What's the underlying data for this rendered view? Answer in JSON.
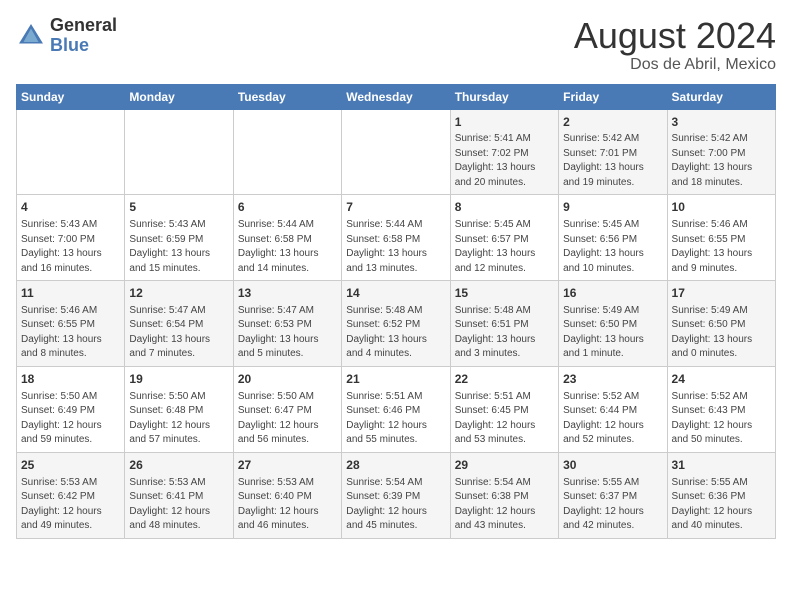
{
  "header": {
    "logo_general": "General",
    "logo_blue": "Blue",
    "title": "August 2024",
    "subtitle": "Dos de Abril, Mexico"
  },
  "weekdays": [
    "Sunday",
    "Monday",
    "Tuesday",
    "Wednesday",
    "Thursday",
    "Friday",
    "Saturday"
  ],
  "weeks": [
    [
      {
        "day": "",
        "info": ""
      },
      {
        "day": "",
        "info": ""
      },
      {
        "day": "",
        "info": ""
      },
      {
        "day": "",
        "info": ""
      },
      {
        "day": "1",
        "info": "Sunrise: 5:41 AM\nSunset: 7:02 PM\nDaylight: 13 hours\nand 20 minutes."
      },
      {
        "day": "2",
        "info": "Sunrise: 5:42 AM\nSunset: 7:01 PM\nDaylight: 13 hours\nand 19 minutes."
      },
      {
        "day": "3",
        "info": "Sunrise: 5:42 AM\nSunset: 7:00 PM\nDaylight: 13 hours\nand 18 minutes."
      }
    ],
    [
      {
        "day": "4",
        "info": "Sunrise: 5:43 AM\nSunset: 7:00 PM\nDaylight: 13 hours\nand 16 minutes."
      },
      {
        "day": "5",
        "info": "Sunrise: 5:43 AM\nSunset: 6:59 PM\nDaylight: 13 hours\nand 15 minutes."
      },
      {
        "day": "6",
        "info": "Sunrise: 5:44 AM\nSunset: 6:58 PM\nDaylight: 13 hours\nand 14 minutes."
      },
      {
        "day": "7",
        "info": "Sunrise: 5:44 AM\nSunset: 6:58 PM\nDaylight: 13 hours\nand 13 minutes."
      },
      {
        "day": "8",
        "info": "Sunrise: 5:45 AM\nSunset: 6:57 PM\nDaylight: 13 hours\nand 12 minutes."
      },
      {
        "day": "9",
        "info": "Sunrise: 5:45 AM\nSunset: 6:56 PM\nDaylight: 13 hours\nand 10 minutes."
      },
      {
        "day": "10",
        "info": "Sunrise: 5:46 AM\nSunset: 6:55 PM\nDaylight: 13 hours\nand 9 minutes."
      }
    ],
    [
      {
        "day": "11",
        "info": "Sunrise: 5:46 AM\nSunset: 6:55 PM\nDaylight: 13 hours\nand 8 minutes."
      },
      {
        "day": "12",
        "info": "Sunrise: 5:47 AM\nSunset: 6:54 PM\nDaylight: 13 hours\nand 7 minutes."
      },
      {
        "day": "13",
        "info": "Sunrise: 5:47 AM\nSunset: 6:53 PM\nDaylight: 13 hours\nand 5 minutes."
      },
      {
        "day": "14",
        "info": "Sunrise: 5:48 AM\nSunset: 6:52 PM\nDaylight: 13 hours\nand 4 minutes."
      },
      {
        "day": "15",
        "info": "Sunrise: 5:48 AM\nSunset: 6:51 PM\nDaylight: 13 hours\nand 3 minutes."
      },
      {
        "day": "16",
        "info": "Sunrise: 5:49 AM\nSunset: 6:50 PM\nDaylight: 13 hours\nand 1 minute."
      },
      {
        "day": "17",
        "info": "Sunrise: 5:49 AM\nSunset: 6:50 PM\nDaylight: 13 hours\nand 0 minutes."
      }
    ],
    [
      {
        "day": "18",
        "info": "Sunrise: 5:50 AM\nSunset: 6:49 PM\nDaylight: 12 hours\nand 59 minutes."
      },
      {
        "day": "19",
        "info": "Sunrise: 5:50 AM\nSunset: 6:48 PM\nDaylight: 12 hours\nand 57 minutes."
      },
      {
        "day": "20",
        "info": "Sunrise: 5:50 AM\nSunset: 6:47 PM\nDaylight: 12 hours\nand 56 minutes."
      },
      {
        "day": "21",
        "info": "Sunrise: 5:51 AM\nSunset: 6:46 PM\nDaylight: 12 hours\nand 55 minutes."
      },
      {
        "day": "22",
        "info": "Sunrise: 5:51 AM\nSunset: 6:45 PM\nDaylight: 12 hours\nand 53 minutes."
      },
      {
        "day": "23",
        "info": "Sunrise: 5:52 AM\nSunset: 6:44 PM\nDaylight: 12 hours\nand 52 minutes."
      },
      {
        "day": "24",
        "info": "Sunrise: 5:52 AM\nSunset: 6:43 PM\nDaylight: 12 hours\nand 50 minutes."
      }
    ],
    [
      {
        "day": "25",
        "info": "Sunrise: 5:53 AM\nSunset: 6:42 PM\nDaylight: 12 hours\nand 49 minutes."
      },
      {
        "day": "26",
        "info": "Sunrise: 5:53 AM\nSunset: 6:41 PM\nDaylight: 12 hours\nand 48 minutes."
      },
      {
        "day": "27",
        "info": "Sunrise: 5:53 AM\nSunset: 6:40 PM\nDaylight: 12 hours\nand 46 minutes."
      },
      {
        "day": "28",
        "info": "Sunrise: 5:54 AM\nSunset: 6:39 PM\nDaylight: 12 hours\nand 45 minutes."
      },
      {
        "day": "29",
        "info": "Sunrise: 5:54 AM\nSunset: 6:38 PM\nDaylight: 12 hours\nand 43 minutes."
      },
      {
        "day": "30",
        "info": "Sunrise: 5:55 AM\nSunset: 6:37 PM\nDaylight: 12 hours\nand 42 minutes."
      },
      {
        "day": "31",
        "info": "Sunrise: 5:55 AM\nSunset: 6:36 PM\nDaylight: 12 hours\nand 40 minutes."
      }
    ]
  ]
}
